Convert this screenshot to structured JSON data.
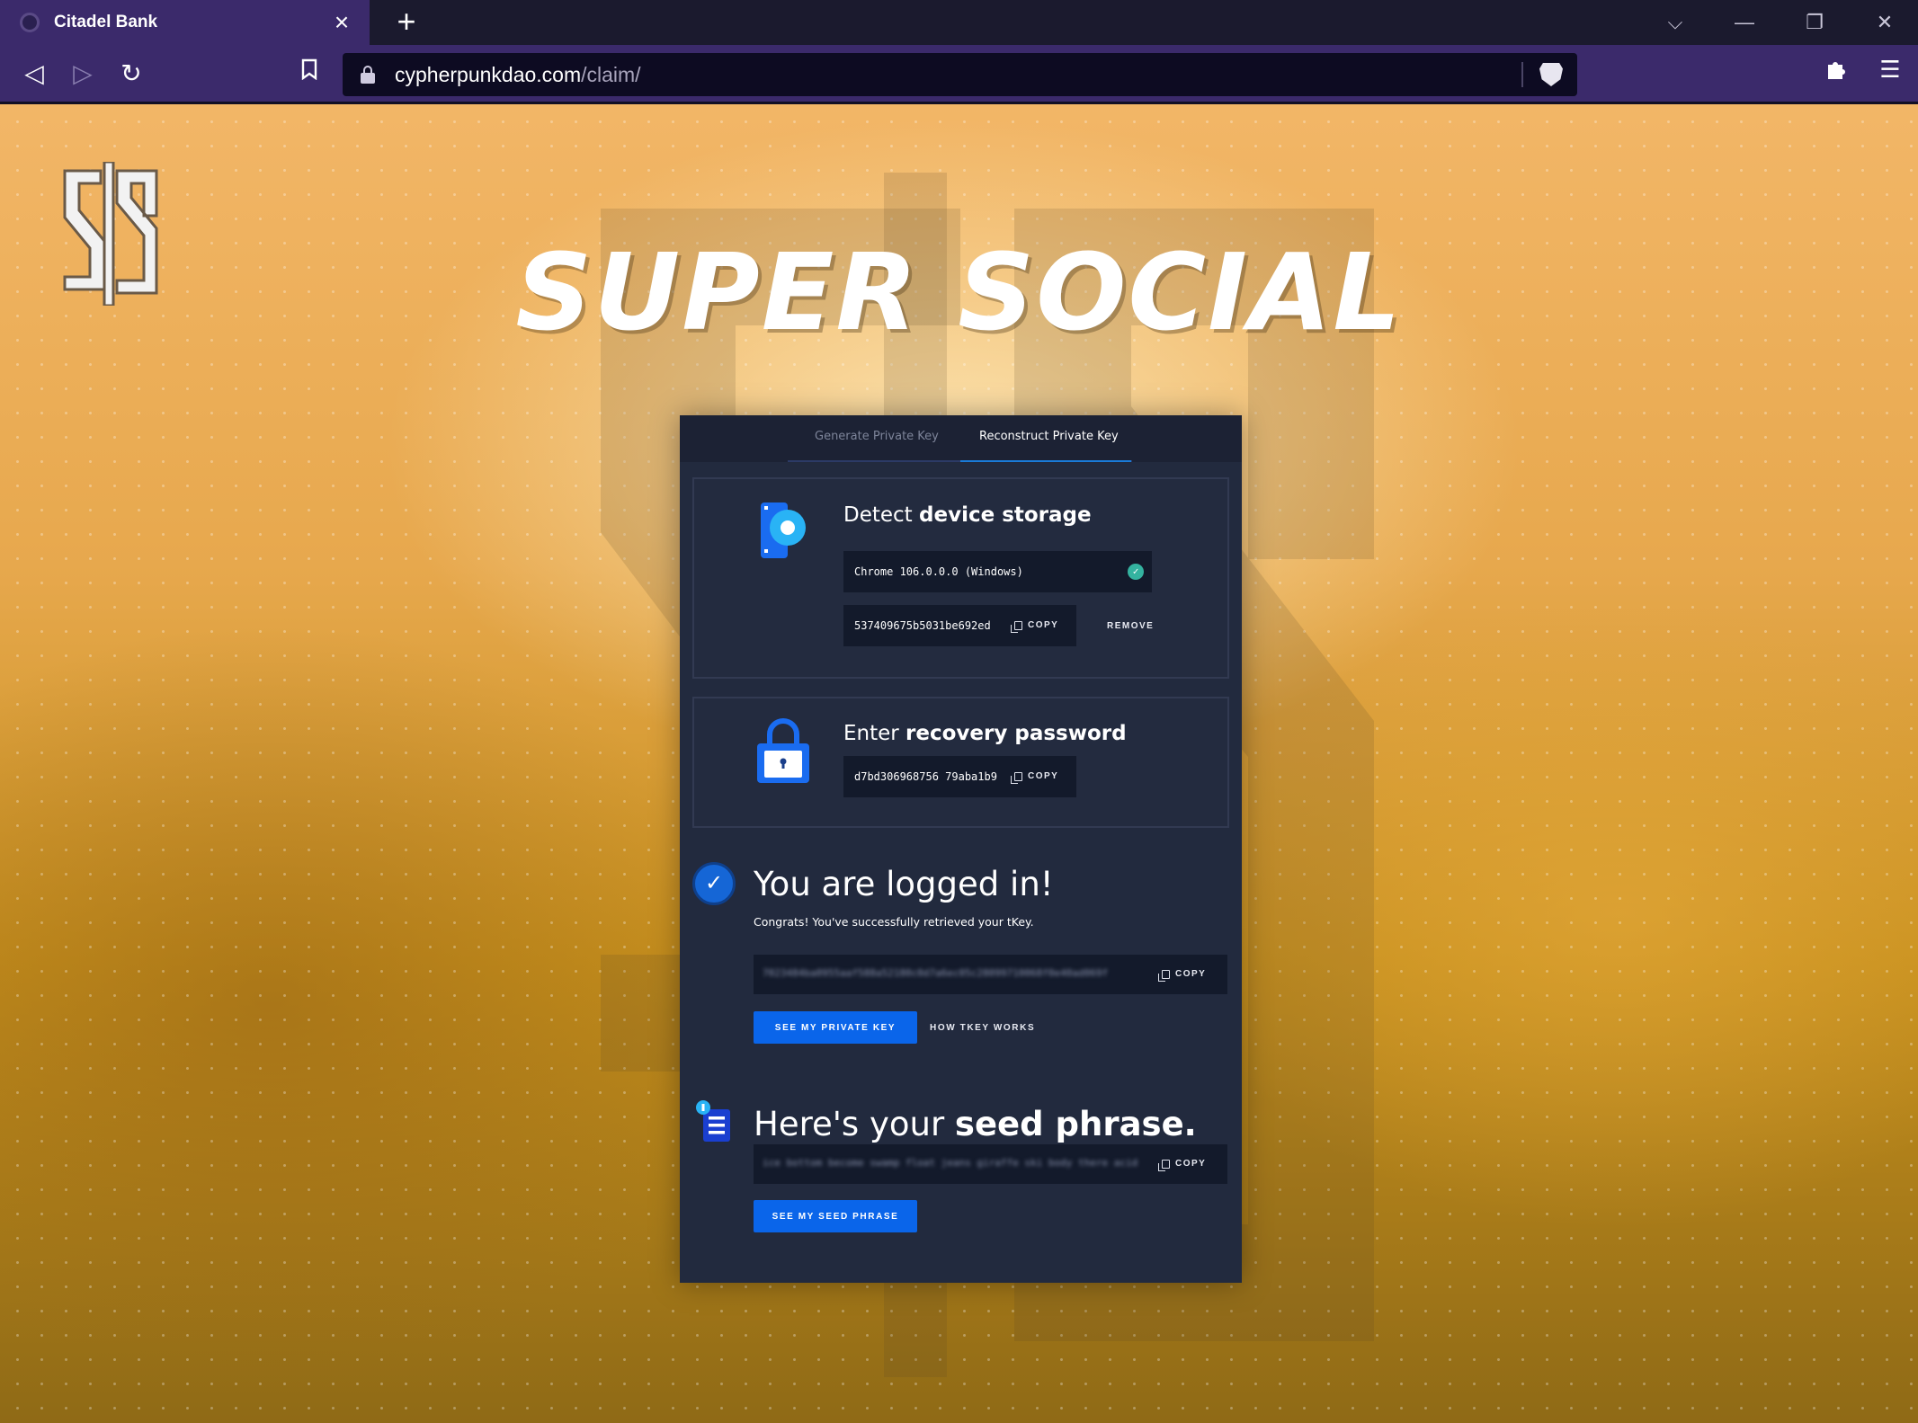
{
  "browser": {
    "tab_title": "Citadel Bank",
    "url_host": "cypherpunkdao.com",
    "url_path": "/claim/"
  },
  "page": {
    "hero_title": "SUPER SOCIAL",
    "logo_glyph": "$"
  },
  "card": {
    "tabs": [
      {
        "label": "Generate Private Key",
        "active": false
      },
      {
        "label": "Reconstruct Private Key",
        "active": true
      }
    ],
    "device_storage": {
      "title_plain": "Detect ",
      "title_bold": "device storage",
      "device": "Chrome 106.0.0.0 (Windows)",
      "share_id": "537409675b5031be692ed",
      "copy_label": "COPY",
      "remove_label": "REMOVE"
    },
    "recovery": {
      "title_plain": "Enter ",
      "title_bold": "recovery password",
      "share_id": "d7bd306968756 79aba1b9",
      "copy_label": "COPY"
    },
    "logged_in": {
      "heading": "You are logged in!",
      "subtext": "Congrats! You've successfully retrieved your tKey.",
      "private_key_masked": "7023484ba0955aaf588a52180c0d7a6ec05c28099710068f0e40ad069f",
      "copy_label": "COPY",
      "see_key_label": "SEE MY PRIVATE KEY",
      "how_label": "HOW TKEY WORKS"
    },
    "seed": {
      "heading_plain": "Here's your ",
      "heading_bold": "seed phrase.",
      "phrase_masked": "ice bottom become swamp float jeans giraffe ski body there acid horse scar",
      "copy_label": "COPY",
      "see_seed_label": "SEE MY SEED PHRASE"
    }
  },
  "colors": {
    "accent": "#0a65ea",
    "card_bg": "#222a3e",
    "chrome_purple": "#3b2a6b"
  }
}
